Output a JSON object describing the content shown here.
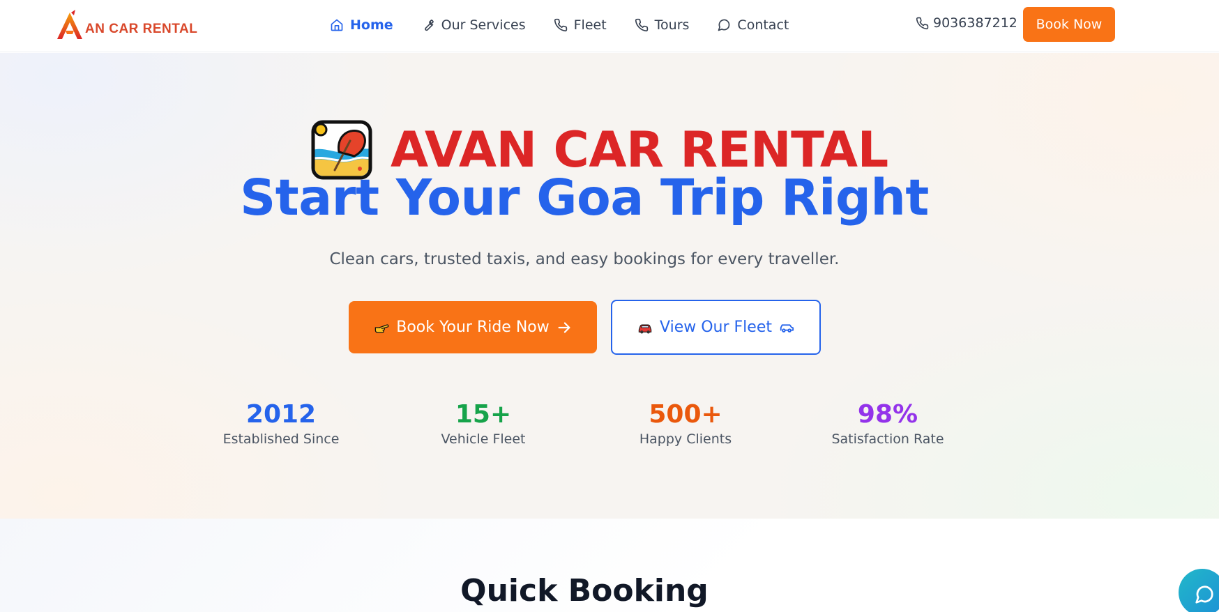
{
  "header": {
    "logo_text": "AN CAR RENTAL",
    "logo_alt": "AVAN CAR RENTAL",
    "nav": [
      {
        "label": "Home",
        "icon": "home-icon",
        "active": true
      },
      {
        "label": "Our Services",
        "icon": "wrench-icon",
        "active": false
      },
      {
        "label": "Fleet",
        "icon": "phone-icon",
        "active": false
      },
      {
        "label": "Tours",
        "icon": "phone-icon",
        "active": false
      },
      {
        "label": "Contact",
        "icon": "chat-icon",
        "active": false
      }
    ],
    "phone": "9036387212",
    "book_now": "Book Now"
  },
  "hero": {
    "brand": "AVAN CAR RENTAL",
    "headline": "Start Your Goa Trip Right",
    "subtitle": "Clean cars, trusted taxis, and easy bookings for every traveller.",
    "primary_button": "Book Your Ride Now",
    "secondary_button": "View Our Fleet",
    "stats": [
      {
        "value": "2012",
        "label": "Established Since",
        "color": "#2563eb"
      },
      {
        "value": "15+",
        "label": "Vehicle Fleet",
        "color": "#16a34a"
      },
      {
        "value": "500+",
        "label": "Happy Clients",
        "color": "#ea580c"
      },
      {
        "value": "98%",
        "label": "Satisfaction Rate",
        "color": "#9333ea"
      }
    ]
  },
  "quick_booking": {
    "title": "Quick Booking"
  },
  "colors": {
    "accent": "#f97316",
    "primary": "#2563eb",
    "brand_red": "#dc2626"
  }
}
